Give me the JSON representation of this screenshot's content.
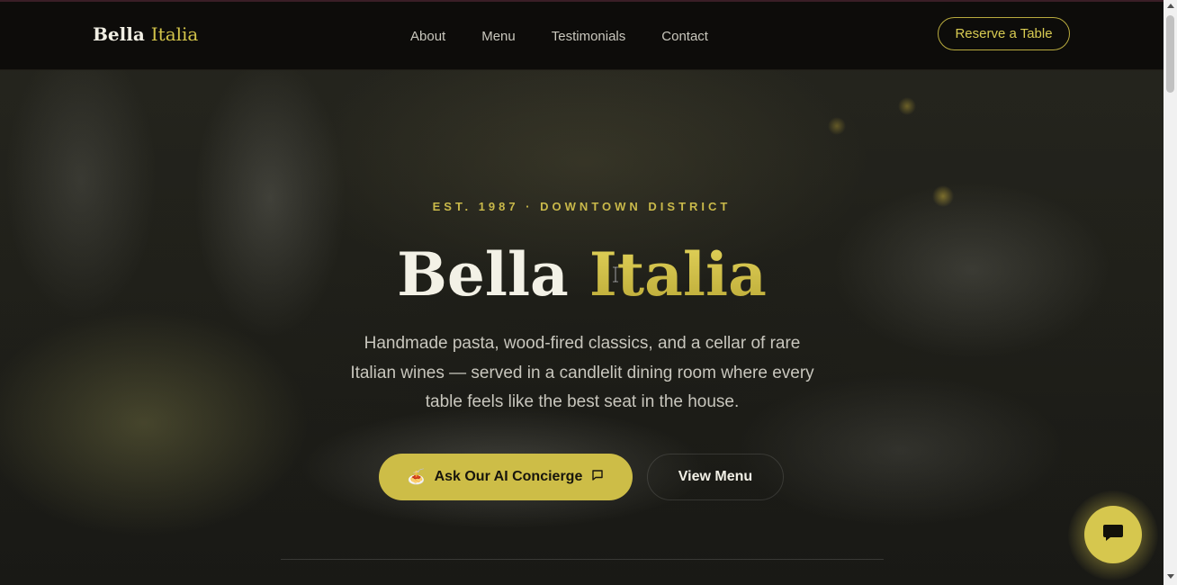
{
  "brand": {
    "name_part1": "Bella",
    "name_part2": "Italia"
  },
  "nav": {
    "links": [
      "About",
      "Menu",
      "Testimonials",
      "Contact"
    ],
    "reserve_label": "Reserve a Table"
  },
  "hero": {
    "eyebrow": "EST. 1987 · DOWNTOWN DISTRICT",
    "title_part1": "Bella",
    "title_part2": "Italia",
    "subtitle": "Handmade pasta, wood-fired classics, and a cellar of rare Italian wines — served in a candlelit dining room where every table feels like the best seat in the house.",
    "primary_cta": {
      "label": "Ask Our AI Concierge",
      "leading_icon": "🍝",
      "trailing_icon": "chat-bubble-icon"
    },
    "secondary_cta": {
      "label": "View Menu"
    }
  },
  "chat_widget": {
    "icon": "chat-icon"
  },
  "colors": {
    "accent": "#cdbd47",
    "nav_bg": "#0d0c0a",
    "text_light": "#f3f1e6",
    "text_muted": "#c8c6bd"
  }
}
